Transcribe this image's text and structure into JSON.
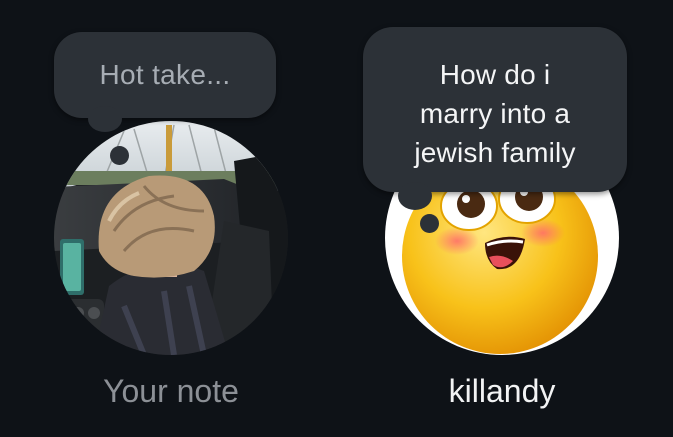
{
  "notes": [
    {
      "id": "self",
      "text": "Hot take...",
      "label": "Your note",
      "avatar": "car-photo-avatar"
    },
    {
      "id": "friend",
      "text": "How do i\nmarry into a\njewish family",
      "label": "killandy",
      "avatar": "blushing-emoji-avatar"
    }
  ],
  "colors": {
    "background": "#0e1217",
    "bubble": "#2c3137",
    "label_muted": "#8c9096",
    "label_active": "#f2f3f4"
  }
}
